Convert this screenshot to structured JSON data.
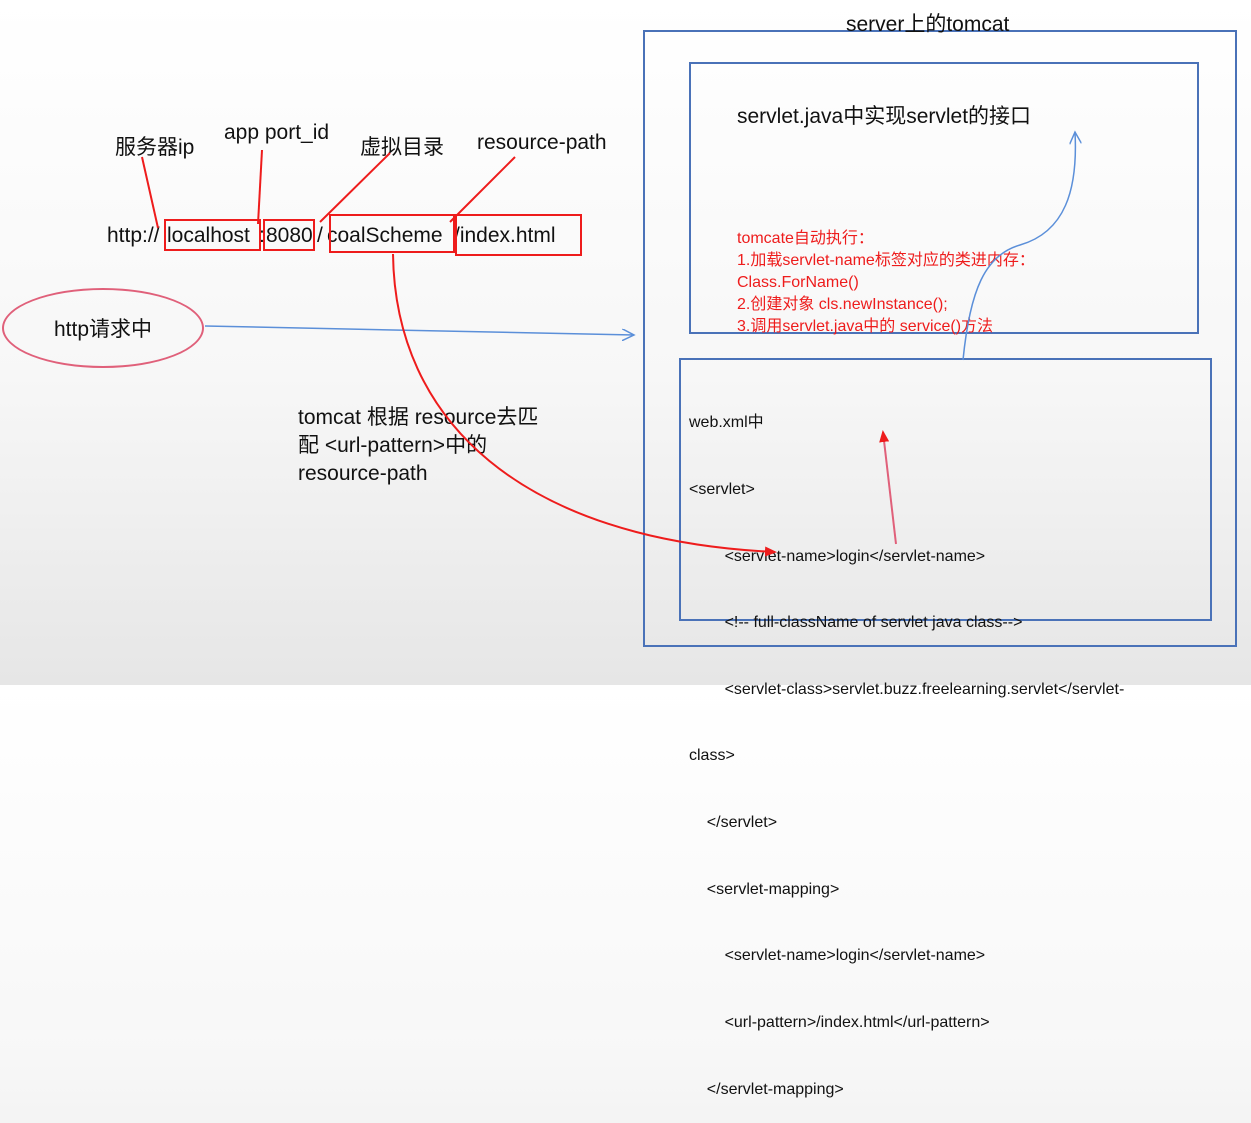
{
  "server_title": "server上的tomcat",
  "servlet_box_title": "servlet.java中实现servlet的接口",
  "labels": {
    "server_ip": "服务器ip",
    "app_port": "app port_id",
    "virtual_dir": "虚拟目录",
    "resource_path": "resource-path"
  },
  "url": {
    "prefix": "http://",
    "host": "localhost",
    "colon": ":",
    "port": "8080",
    "slash": "/",
    "context": "coalScheme",
    "resource": "/index.html"
  },
  "ellipse_label": "http请求中",
  "match_note": [
    "tomcat 根据 resource去匹",
    "配 <url-pattern>中的",
    "resource-path"
  ],
  "tomcat_steps": [
    "tomcate自动执行：",
    "1.加载servlet-name标签对应的类进内存：",
    "Class.ForName()",
    "2.创建对象 cls.newInstance();",
    "3.调用servlet.java中的 service()方法"
  ],
  "webxml": {
    "title": "web.xml中",
    "lines": [
      "<servlet>",
      "        <servlet-name>login</servlet-name>",
      "        <!-- full-className of servlet java class-->",
      "        <servlet-class>servlet.buzz.freelearning.servlet</servlet-",
      "class>",
      "    </servlet>",
      "    <servlet-mapping>",
      "        <servlet-name>login</servlet-name>",
      "        <url-pattern>/index.html</url-pattern>",
      "    </servlet-mapping>"
    ]
  },
  "colors": {
    "red": "#ee1c1c",
    "blue": "#4a72b8",
    "arrow_blue": "#5b8fd9",
    "ellipse": "#e0607a"
  }
}
